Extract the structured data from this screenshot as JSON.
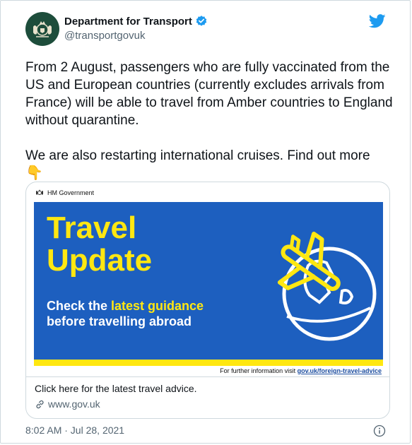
{
  "account": {
    "display_name": "Department for Transport",
    "handle": "@transportgovuk",
    "avatar_icon": "royal-crest-icon",
    "verified_icon": "verified-badge-icon",
    "brand_icon": "twitter-bird-icon"
  },
  "tweet": {
    "paragraph1": "From 2 August, passengers who are fully vaccinated from the US and European countries (currently excludes arrivals from France) will be able to travel from Amber countries to England without quarantine.",
    "paragraph2": "We are also restarting international cruises. Find out more",
    "emoji": "👇"
  },
  "link_card": {
    "org_label": "HM Government",
    "banner": {
      "title_line1": "Travel",
      "title_line2": "Update",
      "sub_pre": "Check the ",
      "sub_highlight": "latest guidance",
      "sub_line2": "before travelling abroad"
    },
    "footer_pre": "For further information visit ",
    "footer_url": "gov.uk/foreign-travel-advice",
    "description": "Click here for the latest travel advice.",
    "domain": "www.gov.uk"
  },
  "meta": {
    "timestamp": "8:02 AM · Jul 28, 2021"
  },
  "colors": {
    "banner_blue": "#1d5fbf",
    "banner_yellow": "#ffe711",
    "twitter_blue": "#1d9bf0",
    "avatar_green": "#1d4d3b"
  }
}
